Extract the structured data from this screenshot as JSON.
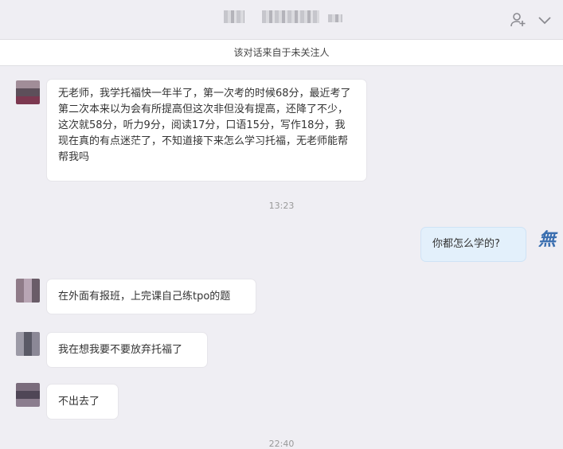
{
  "notice": "该对话来自于未关注人",
  "messages": [
    {
      "text": "无老师，我学托福快一年半了，第一次考的时候68分，最近考了第二次本来以为会有所提高但这次非但没有提高，还降了不少，这次就58分，听力9分，阅读17分，口语15分，写作18分，我现在真的有点迷茫了，不知道接下来怎么学习托福，无老师能帮帮我吗"
    },
    {
      "text": "你都怎么学的?"
    },
    {
      "text": "在外面有报班，上完课自己练tpo的题"
    },
    {
      "text": "我在想我要不要放弃托福了"
    },
    {
      "text": "不出去了"
    }
  ],
  "timestamps": [
    "13:23",
    "22:40"
  ],
  "self_avatar_glyph": "無",
  "icons": {
    "add_contact": "add-user-icon",
    "dropdown": "chevron-down-icon"
  }
}
